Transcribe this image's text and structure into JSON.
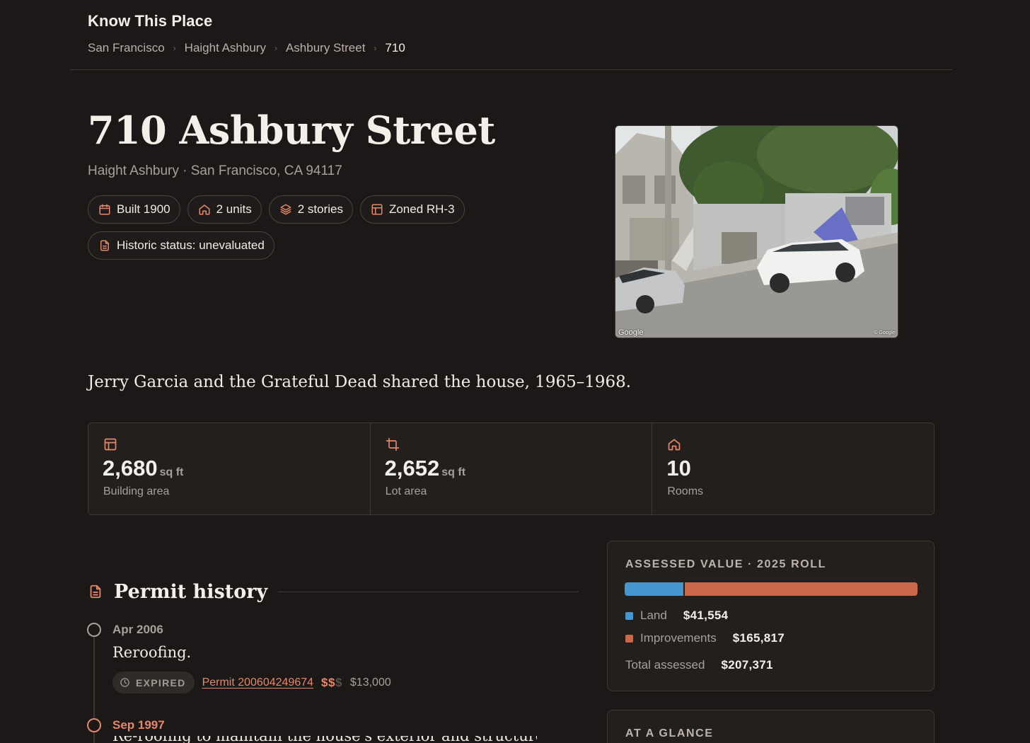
{
  "header": {
    "brand": "Know This Place",
    "breadcrumb": [
      "San Francisco",
      "Haight Ashbury",
      "Ashbury Street",
      "710"
    ]
  },
  "property": {
    "title": "710 Ashbury Street",
    "subtitle": "Haight Ashbury · San Francisco, CA 94117",
    "chips": [
      {
        "icon": "calendar-icon",
        "label": "Built 1900"
      },
      {
        "icon": "home-icon",
        "label": "2 units"
      },
      {
        "icon": "layers-icon",
        "label": "2 stories"
      },
      {
        "icon": "layout-icon",
        "label": "Zoned RH-3"
      },
      {
        "icon": "document-icon",
        "label": "Historic status: unevaluated"
      }
    ],
    "photo": {
      "watermark_left": "Google",
      "watermark_right": "© Google"
    },
    "quote": "Jerry Garcia and the Grateful Dead shared the house, 1965–1968."
  },
  "stats": [
    {
      "icon": "layout-icon",
      "value": "2,680",
      "unit": "sq ft",
      "label": "Building area"
    },
    {
      "icon": "crop-icon",
      "value": "2,652",
      "unit": "sq ft",
      "label": "Lot area"
    },
    {
      "icon": "home-icon",
      "value": "10",
      "unit": "",
      "label": "Rooms"
    }
  ],
  "permits": {
    "title": "Permit history",
    "entries": [
      {
        "date": "Apr 2006",
        "description": "Reroofing.",
        "status": "EXPIRED",
        "permit_link": "Permit 200604249674",
        "cost_tier_on": "$$",
        "cost_tier_off": "$",
        "cost": "$13,000"
      },
      {
        "date": "Sep 1997",
        "description": "Re-roofing to maintain the house's exterior and structure."
      }
    ]
  },
  "assessed": {
    "label": "ASSESSED VALUE · 2025 ROLL",
    "land_label": "Land",
    "land_value": "$41,554",
    "land_amount": 41554,
    "improvements_label": "Improvements",
    "improvements_value": "$165,817",
    "improvements_amount": 165817,
    "total_label": "Total assessed",
    "total_value": "$207,371",
    "colors": {
      "land": "#4896cf",
      "improvements": "#c9694a"
    }
  },
  "glance": {
    "label": "AT A GLANCE"
  },
  "theme": {
    "accent": "#e4886c",
    "background": "#1b1817"
  }
}
